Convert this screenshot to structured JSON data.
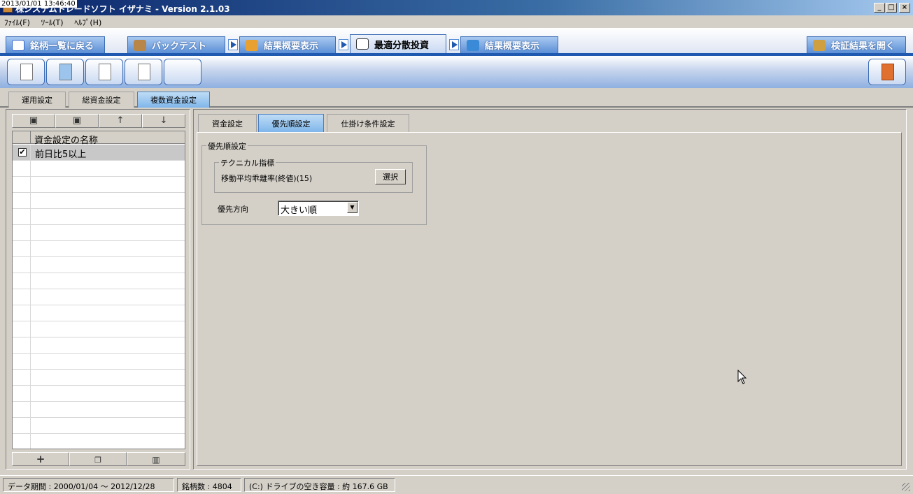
{
  "window": {
    "clock": "2013/01/01 13:46:40",
    "title": "株システムトレードソフト イザナミ - Version 2.1.03",
    "minimize": "_",
    "maximize": "□",
    "close": "×"
  },
  "menu": [
    {
      "label": "ﾌｧｲﾙ(F)"
    },
    {
      "label": "ﾂｰﾙ(T)"
    },
    {
      "label": "ﾍﾙﾌﾟ(H)"
    }
  ],
  "flow_tabs": {
    "back_to_list": "銘柄一覧に戻る",
    "backtest": "バックテスト",
    "summary1": "結果概要表示",
    "optimal": "最適分散投資",
    "summary2": "結果概要表示",
    "open_results": "検証結果を開く"
  },
  "sub_tabs": {
    "operation": "運用設定",
    "total_funds": "総資金設定",
    "multi_funds": "複数資金設定"
  },
  "left_panel": {
    "column_header": "資金設定の名称",
    "rows": [
      {
        "checked": "✔",
        "name": "前日比5以上"
      }
    ],
    "add_button": "+",
    "down_button": "↓",
    "up_button": "↑"
  },
  "right_tabs": {
    "funds": "資金設定",
    "priority": "優先順設定",
    "order": "仕掛け条件設定"
  },
  "priority": {
    "group_title": "優先順設定",
    "tech_group_title": "テクニカル指標",
    "indicator": "移動平均乖離率(終値)(15)",
    "select_button": "選択",
    "direction_label": "優先方向",
    "direction_value": "大きい順",
    "dropdown_arrow": "▼"
  },
  "status": {
    "period": "データ期間 : 2000/01/04 〜 2012/12/28",
    "count": "銘柄数 : 4804",
    "disk": "(C:) ドライブの空き容量 : 約 167.6 GB"
  }
}
